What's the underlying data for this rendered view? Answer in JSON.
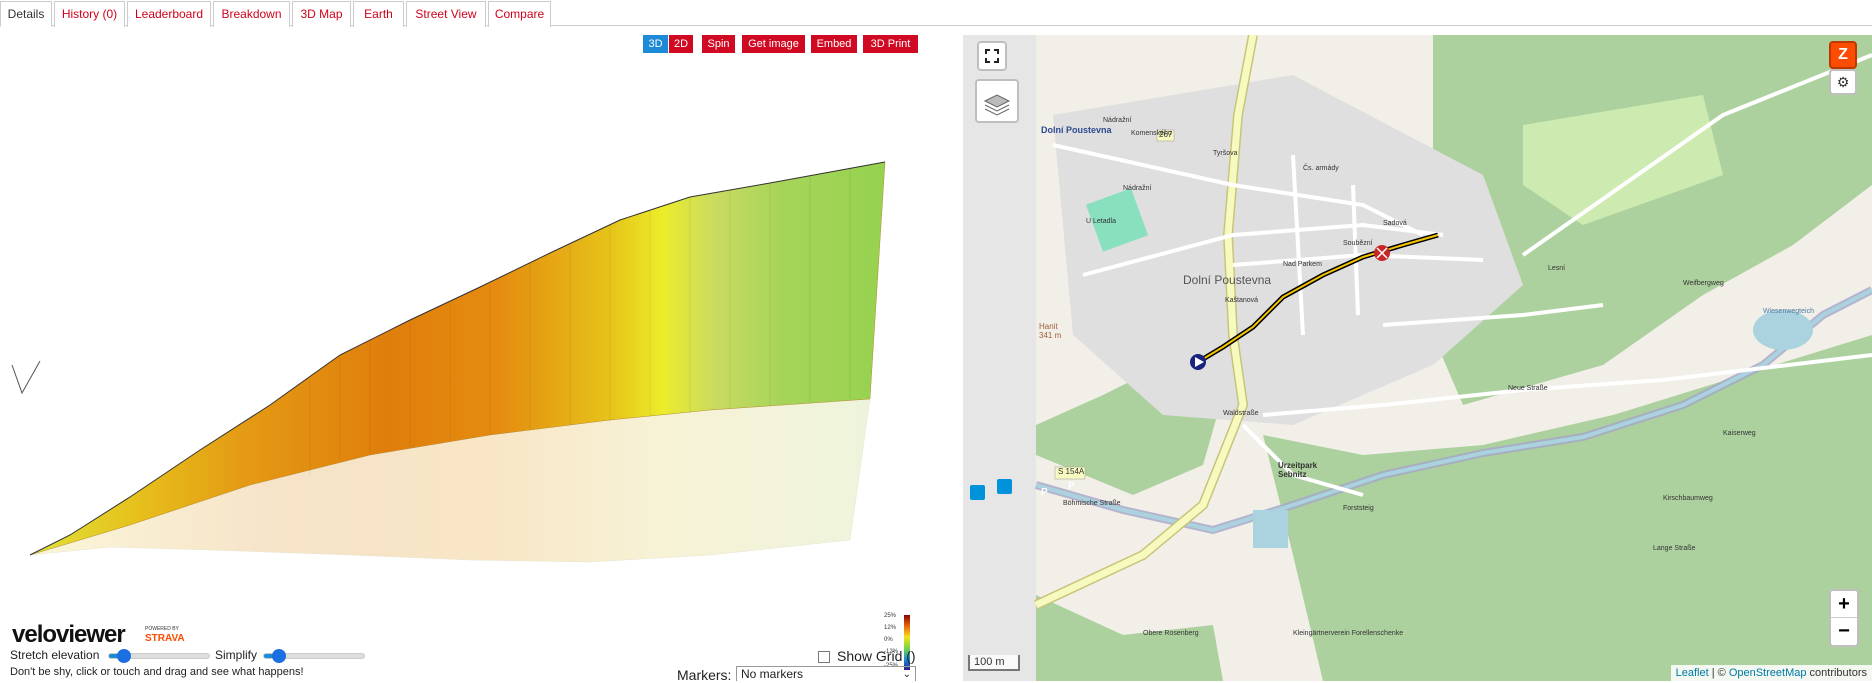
{
  "tabs": [
    {
      "label": "Details",
      "active": true
    },
    {
      "label": "History (0)"
    },
    {
      "label": "Leaderboard"
    },
    {
      "label": "Breakdown"
    },
    {
      "label": "3D Map"
    },
    {
      "label": "Earth"
    },
    {
      "label": "Street View"
    },
    {
      "label": "Compare"
    }
  ],
  "controls": {
    "btn_3d": "3D",
    "btn_2d": "2D",
    "spin": "Spin",
    "get_image": "Get image",
    "embed": "Embed",
    "print3d": "3D Print"
  },
  "logo": {
    "brand": "veloviewer",
    "powered_by": "POWERED BY",
    "strava": "STRAVA"
  },
  "legend": {
    "labels": [
      "25%",
      "12%",
      "0%",
      "-12%",
      "-25%"
    ],
    "colors": [
      "#8b0000",
      "#e8650a",
      "#f5e31b",
      "#78d640",
      "#1d8fd8",
      "#2a1b8a"
    ]
  },
  "bottom": {
    "stretch_label": "Stretch elevation",
    "simplify_label": "Simplify",
    "show_grid_label": "Show Grid ()",
    "hint": "Don't be shy, click or touch and drag and see what happens!",
    "markers_label": "Markers:",
    "markers_value": "No markers"
  },
  "map": {
    "place_main": "Dolní Poustevna",
    "place_top": "Dolní Poustevna",
    "park": "Urzeitpark Sebnitz",
    "road_267": "267",
    "road_s154a": "S 154A",
    "streets": [
      "Nádražní",
      "Komenského",
      "Tyršova",
      "Sadová",
      "Soubězní",
      "Kaštanová",
      "U Letadla",
      "Nad Parkem",
      "Čs. armády",
      "Neue Straße",
      "Lange Straße",
      "Böhmische Straße",
      "Forststeig",
      "Waldstraße",
      "Obere Rosenberg",
      "Weifbergweg",
      "Kleingärtnerverein Forellenschenke",
      "Nádražní",
      "Lesní",
      "Wiesenwegteich",
      "Kirschbaumweg",
      "Kaiserweg"
    ],
    "scale": "100 m",
    "zoom_in": "+",
    "zoom_out": "−",
    "attrib_leaflet": "Leaflet",
    "attrib_sep": " | © ",
    "attrib_osm": "OpenStreetMap",
    "attrib_contrib": " contributors",
    "hamlet": "Hanit",
    "elev": "341 m",
    "parking": "P"
  }
}
